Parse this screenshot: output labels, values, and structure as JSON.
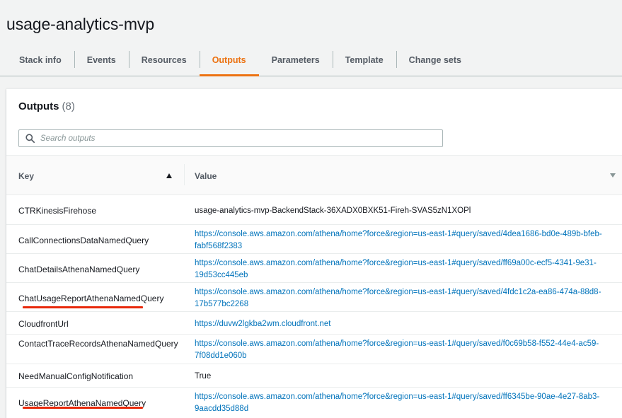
{
  "stack": {
    "title": "usage-analytics-mvp"
  },
  "tabs": [
    {
      "label": "Stack info",
      "active": false
    },
    {
      "label": "Events",
      "active": false
    },
    {
      "label": "Resources",
      "active": false
    },
    {
      "label": "Outputs",
      "active": true
    },
    {
      "label": "Parameters",
      "active": false
    },
    {
      "label": "Template",
      "active": false
    },
    {
      "label": "Change sets",
      "active": false
    }
  ],
  "outputs": {
    "heading": "Outputs",
    "count": "(8)",
    "search_placeholder": "Search outputs",
    "columns": {
      "key": "Key",
      "value": "Value"
    },
    "rows": [
      {
        "key": "CTRKinesisFirehose",
        "value": "usage-analytics-mvp-BackendStack-36XADX0BXK51-Fireh-SVAS5zN1XOPl",
        "link": false
      },
      {
        "key": "CallConnectionsDataNamedQuery",
        "value": "https://console.aws.amazon.com/athena/home?force&region=us-east-1#query/saved/4dea1686-bd0e-489b-bfeb-fabf568f2383",
        "link": true
      },
      {
        "key": "ChatDetailsAthenaNamedQuery",
        "value": "https://console.aws.amazon.com/athena/home?force&region=us-east-1#query/saved/ff69a00c-ecf5-4341-9e31-19d53cc445eb",
        "link": true
      },
      {
        "key": "ChatUsageReportAthenaNamedQuery",
        "value": "https://console.aws.amazon.com/athena/home?force&region=us-east-1#query/saved/4fdc1c2a-ea86-474a-88d8-17b577bc2268",
        "link": true
      },
      {
        "key": "CloudfrontUrl",
        "value": "https://duvw2lgkba2wm.cloudfront.net",
        "link": true
      },
      {
        "key": "ContactTraceRecordsAthenaNamedQuery",
        "value": "https://console.aws.amazon.com/athena/home?force&region=us-east-1#query/saved/f0c69b58-f552-44e4-ac59-7f08dd1e060b",
        "link": true
      },
      {
        "key": "NeedManualConfigNotification",
        "value": "True",
        "link": false
      },
      {
        "key": "UsageReportAthenaNamedQuery",
        "value": "https://console.aws.amazon.com/athena/home?force&region=us-east-1#query/saved/ff6345be-90ae-4e27-8ab3-9aacdd35d88d",
        "link": true
      }
    ]
  },
  "colors": {
    "accent": "#ec7211",
    "link": "#0073bb",
    "highlight": "#e8290b"
  },
  "icons": {
    "search": "search-icon",
    "sort_asc": "caret-up-icon",
    "sort_desc": "caret-down-icon"
  }
}
